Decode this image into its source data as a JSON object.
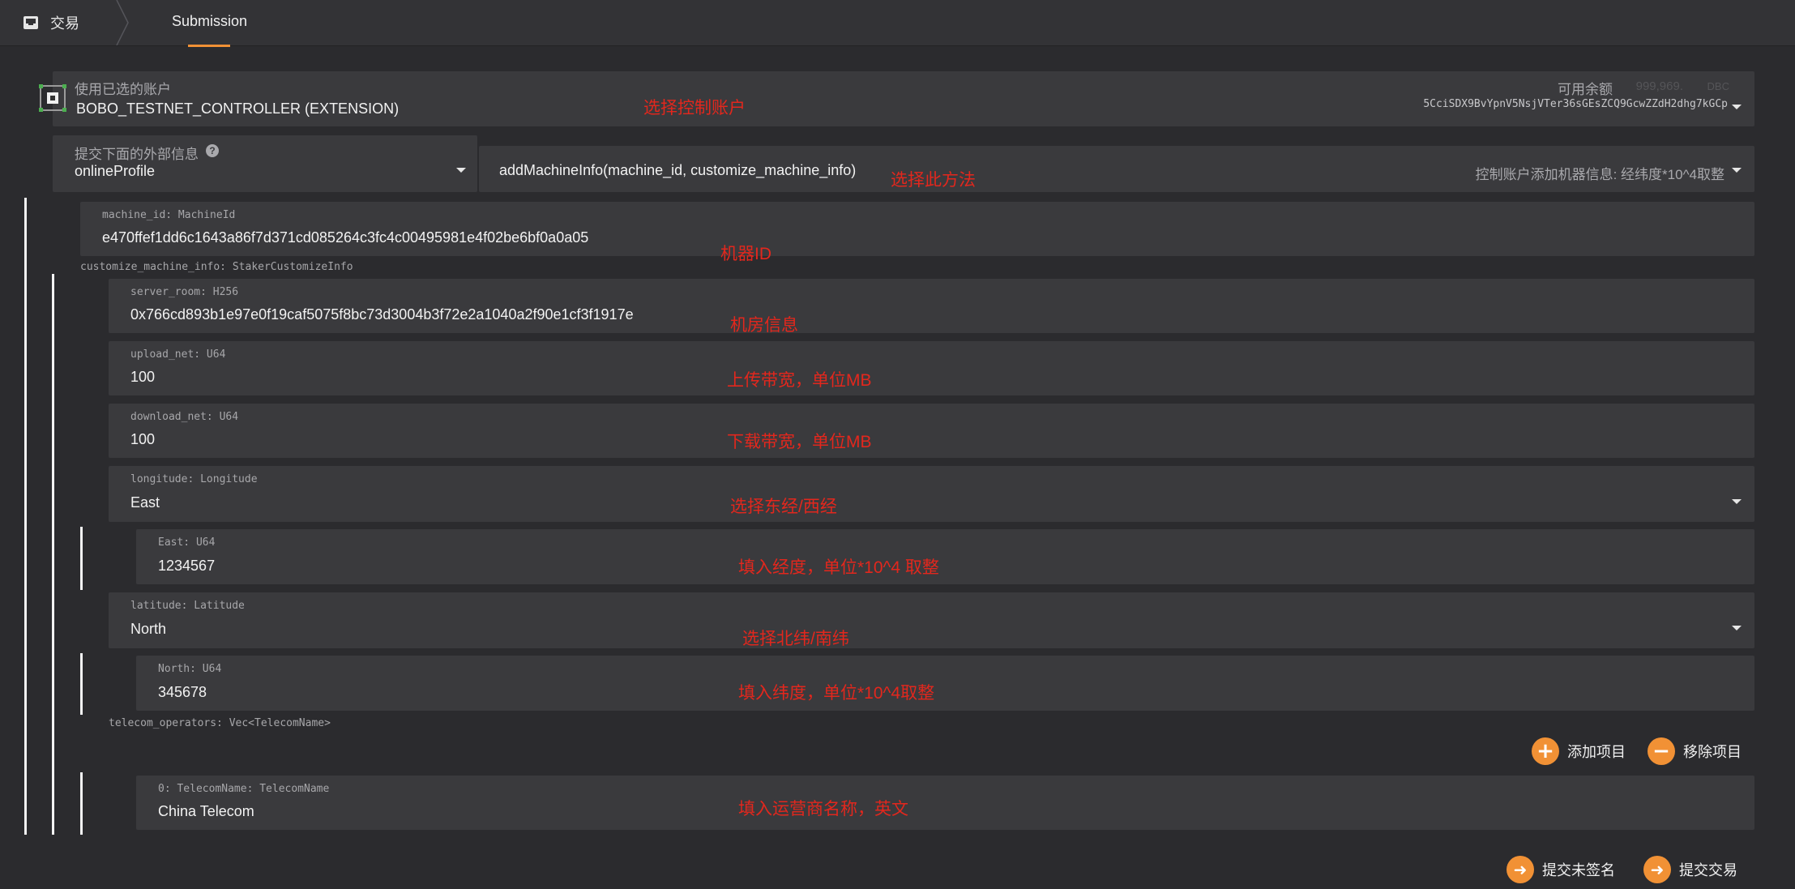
{
  "header": {
    "app_label": "交易",
    "tab_label": "Submission",
    "accent": "#f19135"
  },
  "account": {
    "label": "使用已选的账户",
    "value": "BOBO_TESTNET_CONTROLLER (EXTENSION)",
    "balance_label": "可用余额",
    "balance_value": "999,969.",
    "balance_unit": "DBC",
    "address": "5CciSDX9BvYpnV5NsjVTer36sGEsZCQ9GcwZZdH2dhg7kGCp"
  },
  "extrinsic": {
    "label": "提交下面的外部信息",
    "module": "onlineProfile",
    "method": "addMachineInfo(machine_id, customize_machine_info)",
    "method_desc": "控制账户添加机器信息: 经纬度*10^4取整"
  },
  "params": {
    "machine_id_label": "machine_id: MachineId",
    "machine_id_value": "e470ffef1dd6c1643a86f7d371cd085264c3fc4c00495981e4f02be6bf0a0a05",
    "customize_label": "customize_machine_info: StakerCustomizeInfo",
    "server_room_label": "server_room: H256",
    "server_room_value": "0x766cd893b1e97e0f19caf5075f8bc73d3004b3f72e2a1040a2f90e1cf3f1917e",
    "upload_net_label": "upload_net: U64",
    "upload_net_value": "100",
    "download_net_label": "download_net: U64",
    "download_net_value": "100",
    "longitude_label": "longitude: Longitude",
    "longitude_value": "East",
    "east_label": "East: U64",
    "east_value": "1234567",
    "latitude_label": "latitude: Latitude",
    "latitude_value": "North",
    "north_label": "North: U64",
    "north_value": "345678",
    "telecom_label": "telecom_operators: Vec<TelecomName>",
    "add_item": "添加项目",
    "remove_item": "移除项目",
    "telecom0_label": "0: TelecomName: TelecomName",
    "telecom0_value": "China Telecom"
  },
  "actions": {
    "submit_unsigned": "提交未签名",
    "submit": "提交交易"
  },
  "annotations": {
    "select_account": "选择控制账户",
    "select_method": "选择此方法",
    "machine_id": "机器ID",
    "room_info": "机房信息",
    "upload": "上传带宽，单位MB",
    "download": "下载带宽，单位MB",
    "longitude": "选择东经/西经",
    "east": "填入经度，单位*10^4 取整",
    "latitude": "选择北纬/南纬",
    "north": "填入纬度，单位*10^4取整",
    "telecom": "填入运营商名称，英文"
  }
}
